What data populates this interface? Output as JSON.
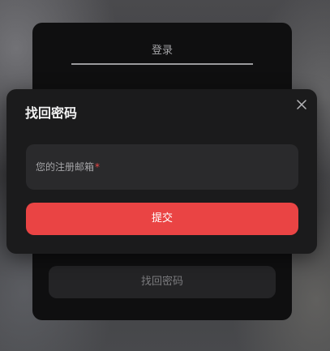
{
  "login_card": {
    "tab_label": "登录",
    "find_password_button": "找回密码"
  },
  "modal": {
    "title": "找回密码",
    "email_field": {
      "label": "您的注册邮箱",
      "required_mark": "*"
    },
    "submit_label": "提交",
    "close_icon": "close-icon"
  },
  "colors": {
    "accent": "#ea4444",
    "modal_bg": "#1b1b1c",
    "field_bg": "#2a2a2c",
    "card_bg": "#0f0f10"
  }
}
